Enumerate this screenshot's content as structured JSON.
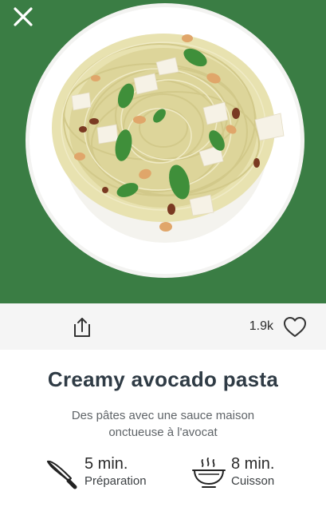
{
  "recipe": {
    "title": "Creamy avocado pasta",
    "description": "Des pâtes avec une sauce maison onctueuse à l'avocat",
    "likes": "1.9k",
    "prep": {
      "value": "5 min.",
      "label": "Préparation"
    },
    "cook": {
      "value": "8 min.",
      "label": "Cuisson"
    }
  },
  "colors": {
    "hero_background": "#3a7d44",
    "action_bar": "#f5f5f5",
    "title": "#2f3b45"
  },
  "icons": {
    "close": "close-icon",
    "share": "share-icon",
    "like": "heart-icon",
    "prep": "knife-icon",
    "cook": "steaming-bowl-icon"
  }
}
